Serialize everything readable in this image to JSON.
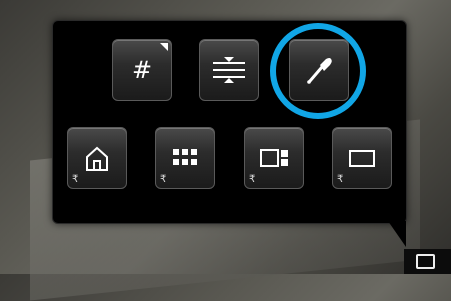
{
  "toolbar": {
    "row1": [
      {
        "name": "grid-button",
        "icon": "hash-grid-icon",
        "glyph": "#",
        "has_corner_indicator": true
      },
      {
        "name": "guide-lines-button",
        "icon": "guide-lines-icon"
      },
      {
        "name": "eyedropper-button",
        "icon": "eyedropper-icon",
        "highlighted": true
      }
    ],
    "row2": [
      {
        "name": "home-button",
        "icon": "home-icon",
        "sub_glyph": "₹"
      },
      {
        "name": "grid-view-button",
        "icon": "grid-view-icon",
        "sub_glyph": "₹"
      },
      {
        "name": "split-view-button",
        "icon": "split-view-icon",
        "sub_glyph": "₹"
      },
      {
        "name": "single-view-button",
        "icon": "single-view-icon",
        "sub_glyph": "₹"
      }
    ]
  },
  "colors": {
    "highlight_ring": "#11a6e6",
    "popup_bg": "#000000"
  },
  "taskbar": {
    "icon": "comment-icon"
  }
}
